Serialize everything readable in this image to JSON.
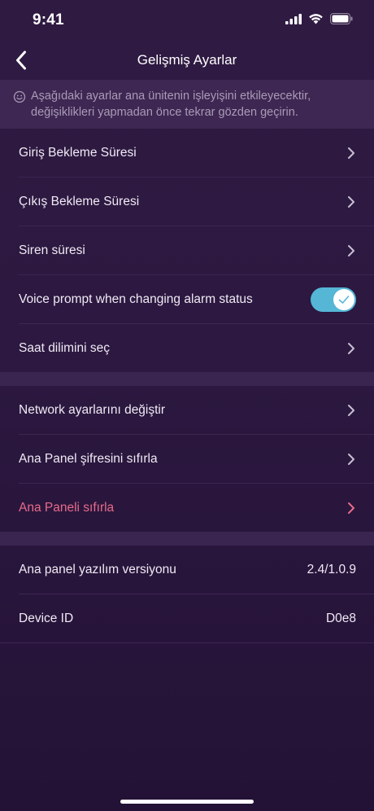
{
  "status_bar": {
    "time": "9:41"
  },
  "nav": {
    "title": "Gelişmiş Ayarlar",
    "back_icon": "chevron-left-icon"
  },
  "notice": {
    "icon": "smiley-icon",
    "text": "Aşağıdaki ayarlar ana ünitenin işleyişini etkileyecektir, değişiklikleri yapmadan önce tekrar gözden geçirin."
  },
  "group1": [
    {
      "label": "Giriş Bekleme Süresi"
    },
    {
      "label": "Çıkış Bekleme Süresi"
    },
    {
      "label": "Siren süresi"
    },
    {
      "label": "Voice prompt when changing alarm status",
      "toggle_on": true
    },
    {
      "label": "Saat dilimini seç"
    }
  ],
  "group2": [
    {
      "label": "Network ayarlarını değiştir"
    },
    {
      "label": "Ana Panel şifresini sıfırla"
    },
    {
      "label": "Ana Paneli sıfırla"
    }
  ],
  "group3": [
    {
      "label": "Ana panel yazılım versiyonu",
      "value": "2.4/1.0.9"
    },
    {
      "label": "Device ID",
      "value": "D0e8"
    }
  ],
  "colors": {
    "background": "#2f1a42",
    "accent_toggle": "#55b6d6",
    "danger": "#e86b8a"
  }
}
